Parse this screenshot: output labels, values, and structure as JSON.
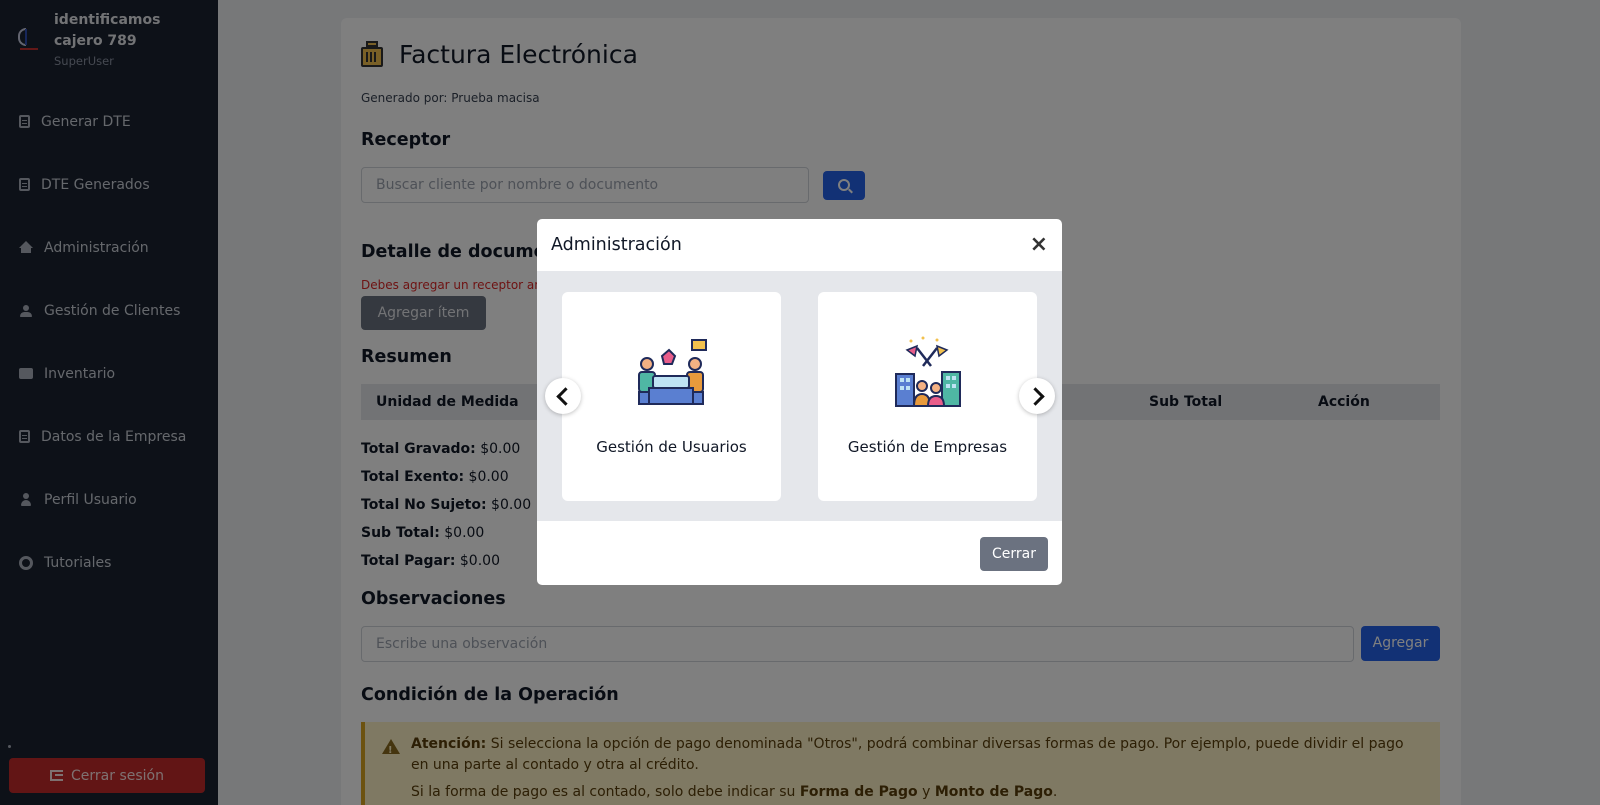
{
  "sidebar": {
    "brand_name": "identificamos cajero 789",
    "brand_role": "SuperUser",
    "items": [
      {
        "label": "Generar DTE",
        "icon": "document-icon"
      },
      {
        "label": "DTE Generados",
        "icon": "document-icon"
      },
      {
        "label": "Administración",
        "icon": "home-icon"
      },
      {
        "label": "Gestión de Clientes",
        "icon": "users-icon"
      },
      {
        "label": "Inventario",
        "icon": "box-icon"
      },
      {
        "label": "Datos de la Empresa",
        "icon": "document-icon"
      },
      {
        "label": "Perfil Usuario",
        "icon": "user-icon"
      },
      {
        "label": "Tutoriales",
        "icon": "help-icon"
      }
    ],
    "logout_label": "Cerrar sesión"
  },
  "main": {
    "title": "Factura Electrónica",
    "generated_by": "Generado por: Prueba macisa",
    "receptor_heading": "Receptor",
    "search_placeholder": "Buscar cliente por nombre o documento",
    "detalle_heading": "Detalle de documento",
    "error_text": "Debes agregar un receptor ante",
    "add_item_label": "Agregar ítem",
    "resumen_heading": "Resumen",
    "table_headers": {
      "unidad": "Unidad de Medida",
      "subtotal": "Sub Total",
      "accion": "Acción"
    },
    "totals": [
      {
        "label": "Total Gravado:",
        "value": "$0.00"
      },
      {
        "label": "Total Exento:",
        "value": "$0.00"
      },
      {
        "label": "Total No Sujeto:",
        "value": "$0.00"
      },
      {
        "label": "Sub Total:",
        "value": "$0.00"
      },
      {
        "label": "Total Pagar:",
        "value": "$0.00"
      }
    ],
    "obs_heading": "Observaciones",
    "obs_placeholder": "Escribe una observación",
    "obs_add_label": "Agregar",
    "condicion_heading": "Condición de la Operación",
    "alert": {
      "strong": "Atención:",
      "line1": " Si selecciona la opción de pago denominada \"Otros\", podrá combinar diversas formas de pago. Por ejemplo, puede dividir el pago en una parte al contado y otra al crédito.",
      "line2_pre": "Si la forma de pago es al contado, solo debe indicar su ",
      "line2_b1": "Forma de Pago",
      "line2_mid": " y ",
      "line2_b2": "Monto de Pago",
      "line2_end": "."
    }
  },
  "modal": {
    "title": "Administración",
    "close_symbol": "×",
    "cards": [
      {
        "label": "Gestión de Usuarios",
        "icon": "team-meeting-icon"
      },
      {
        "label": "Gestión de Empresas",
        "icon": "company-buildings-icon"
      }
    ],
    "close_label": "Cerrar"
  }
}
